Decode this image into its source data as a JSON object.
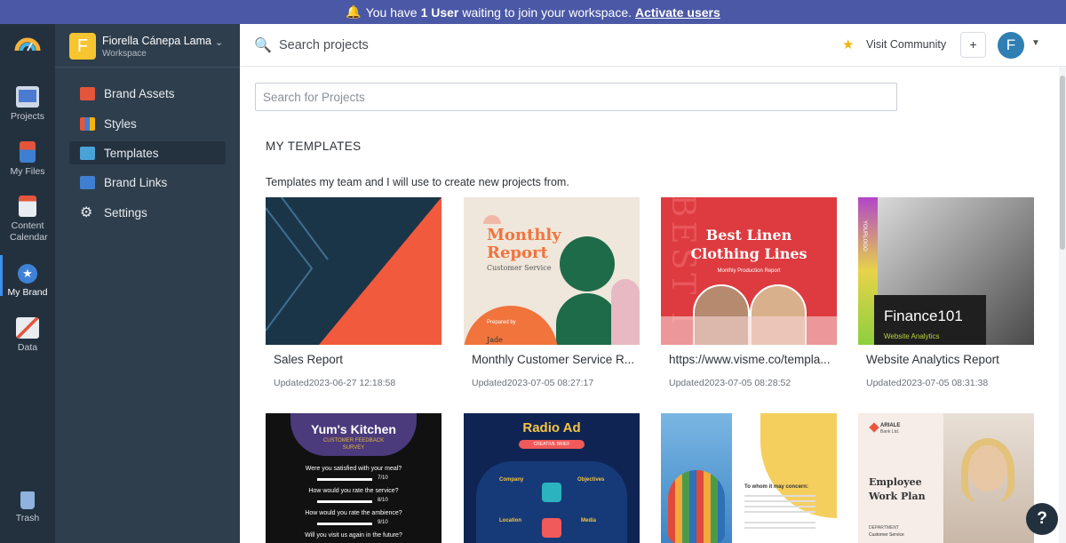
{
  "banner": {
    "pre": "You have",
    "count": "1 User",
    "post": "waiting to join your workspace.",
    "action": "Activate users"
  },
  "rail": {
    "items": [
      {
        "label": "Projects"
      },
      {
        "label": "My Files"
      },
      {
        "label": "Content Calendar"
      },
      {
        "label": "My Brand"
      },
      {
        "label": "Data"
      },
      {
        "label": "Trash"
      }
    ]
  },
  "workspace": {
    "initial": "F",
    "name": "Fiorella Cánepa Lama",
    "type": "Workspace"
  },
  "nav": {
    "items": [
      {
        "label": "Brand Assets"
      },
      {
        "label": "Styles"
      },
      {
        "label": "Templates"
      },
      {
        "label": "Brand Links"
      },
      {
        "label": "Settings"
      }
    ]
  },
  "topbar": {
    "search_label": "Search projects",
    "community": "Visit Community",
    "user_initial": "F"
  },
  "main": {
    "search_placeholder": "Search for Projects",
    "heading": "MY TEMPLATES",
    "description": "Templates my team and I will use to create new projects from."
  },
  "cards": [
    {
      "title": "Sales Report",
      "date": "Updated2023-06-27 12:18:58"
    },
    {
      "title": "Monthly Customer Service R...",
      "date": "Updated2023-07-05 08:27:17",
      "thumb": {
        "t1": "Monthly",
        "t2": "Report",
        "t3": "Customer Service",
        "t4": "Prepared by",
        "t5": "Jade"
      }
    },
    {
      "title": "https://www.visme.co/templa...",
      "date": "Updated2023-07-05 08:28:52",
      "thumb": {
        "t1": "Best Linen",
        "t2": "Clothing Lines",
        "t3": "Monthly Production Report",
        "t4": "BEST I"
      }
    },
    {
      "title": "Website Analytics Report",
      "date": "Updated2023-07-05 08:31:38",
      "thumb": {
        "t1": "Finance101",
        "t2": "Website Analytics",
        "t3": "YOURLOGO"
      }
    },
    {
      "thumb": {
        "t1": "Yum's Kitchen",
        "t2": "CUSTOMER FEEDBACK",
        "t3": "SURVEY",
        "q1": "Were you satisfied with your meal?",
        "v1": "7/10",
        "q2": "How would you rate the service?",
        "v2": "8/10",
        "q3": "How would you rate the ambience?",
        "v3": "9/10",
        "q4": "Will you visit us again in the future?"
      }
    },
    {
      "thumb": {
        "t1": "Radio Ad",
        "t2": "CREATIVE BRIEF",
        "t3": "Company",
        "t4": "Objectives",
        "t5": "Location",
        "t6": "Media"
      }
    },
    {
      "thumb": {
        "t1": "To whom it may concern:"
      }
    },
    {
      "thumb": {
        "t1": "ARIALE",
        "t2": "Bank Ltd.",
        "t3": "Employee",
        "t4": "Work Plan",
        "t5": "DEPARTMENT",
        "t6": "Customer Service"
      }
    }
  ],
  "help": {
    "label": "?"
  },
  "colors": {
    "accent": "#3d8ff0",
    "rail": "#23313f",
    "sidebar": "#2f3e4c",
    "banner": "#4b58a6"
  }
}
